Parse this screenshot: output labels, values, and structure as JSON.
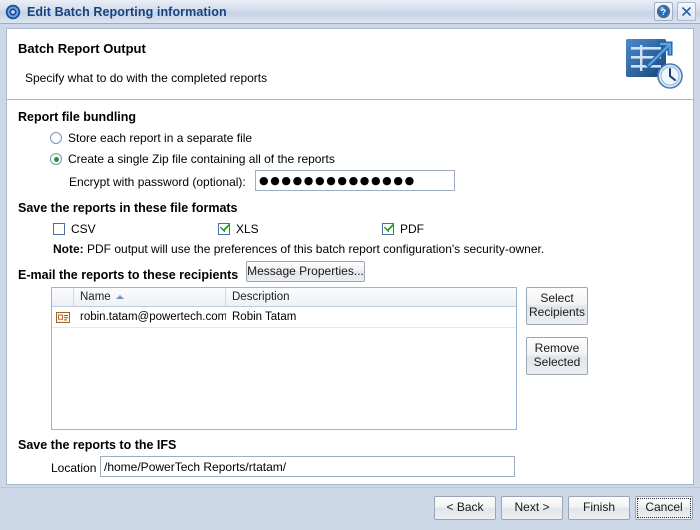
{
  "window": {
    "title": "Edit Batch Reporting information",
    "icon": "ring-icon",
    "help_button": "?",
    "close_button": "✕"
  },
  "header": {
    "title": "Batch Report Output",
    "subtitle": "Specify what to do with the completed reports",
    "logo_icon": "batch-report-schedule-icon"
  },
  "bundling": {
    "section_title": "Report file bundling",
    "option_separate": "Store each report in a separate file",
    "option_zip": "Create a single Zip file containing all of the reports",
    "selected": "zip",
    "password_label": "Encrypt with password (optional):",
    "password_value": "●●●●●●●●●●●●●●"
  },
  "formats": {
    "section_title": "Save the reports in these file formats",
    "items": [
      {
        "label": "CSV",
        "checked": false
      },
      {
        "label": "XLS",
        "checked": true
      },
      {
        "label": "PDF",
        "checked": true
      }
    ],
    "note_label": "Note:",
    "note_text": " PDF output will use the preferences of this batch report configuration's security-owner."
  },
  "email": {
    "section_title": "E-mail the reports to these recipients",
    "message_properties_button": "Message Properties...",
    "select_recipients_button": "Select\nRecipients",
    "select_recipients_line1": "Select",
    "select_recipients_line2": "Recipients",
    "remove_selected_line1": "Remove",
    "remove_selected_line2": "Selected",
    "columns": [
      "",
      "Name",
      "Description"
    ],
    "sort_column": "Name",
    "sort_direction": "ascending",
    "rows": [
      {
        "icon": "contact-card-icon",
        "name": "robin.tatam@powertech.com",
        "description": "Robin Tatam"
      }
    ]
  },
  "ifs": {
    "section_title": "Save the reports to the IFS",
    "location_label": "Location",
    "location_value": "/home/PowerTech Reports/rtatam/"
  },
  "footer": {
    "back_button": "< Back",
    "next_button": "Next >",
    "finish_button": "Finish",
    "cancel_button": "Cancel",
    "focused": "cancel"
  },
  "colors": {
    "title_text": "#17427e",
    "window_chrome": "#ccd8e8",
    "check_green": "#18a02b",
    "radio_green": "#1f9b2e",
    "content_bg": "#ffffff"
  }
}
